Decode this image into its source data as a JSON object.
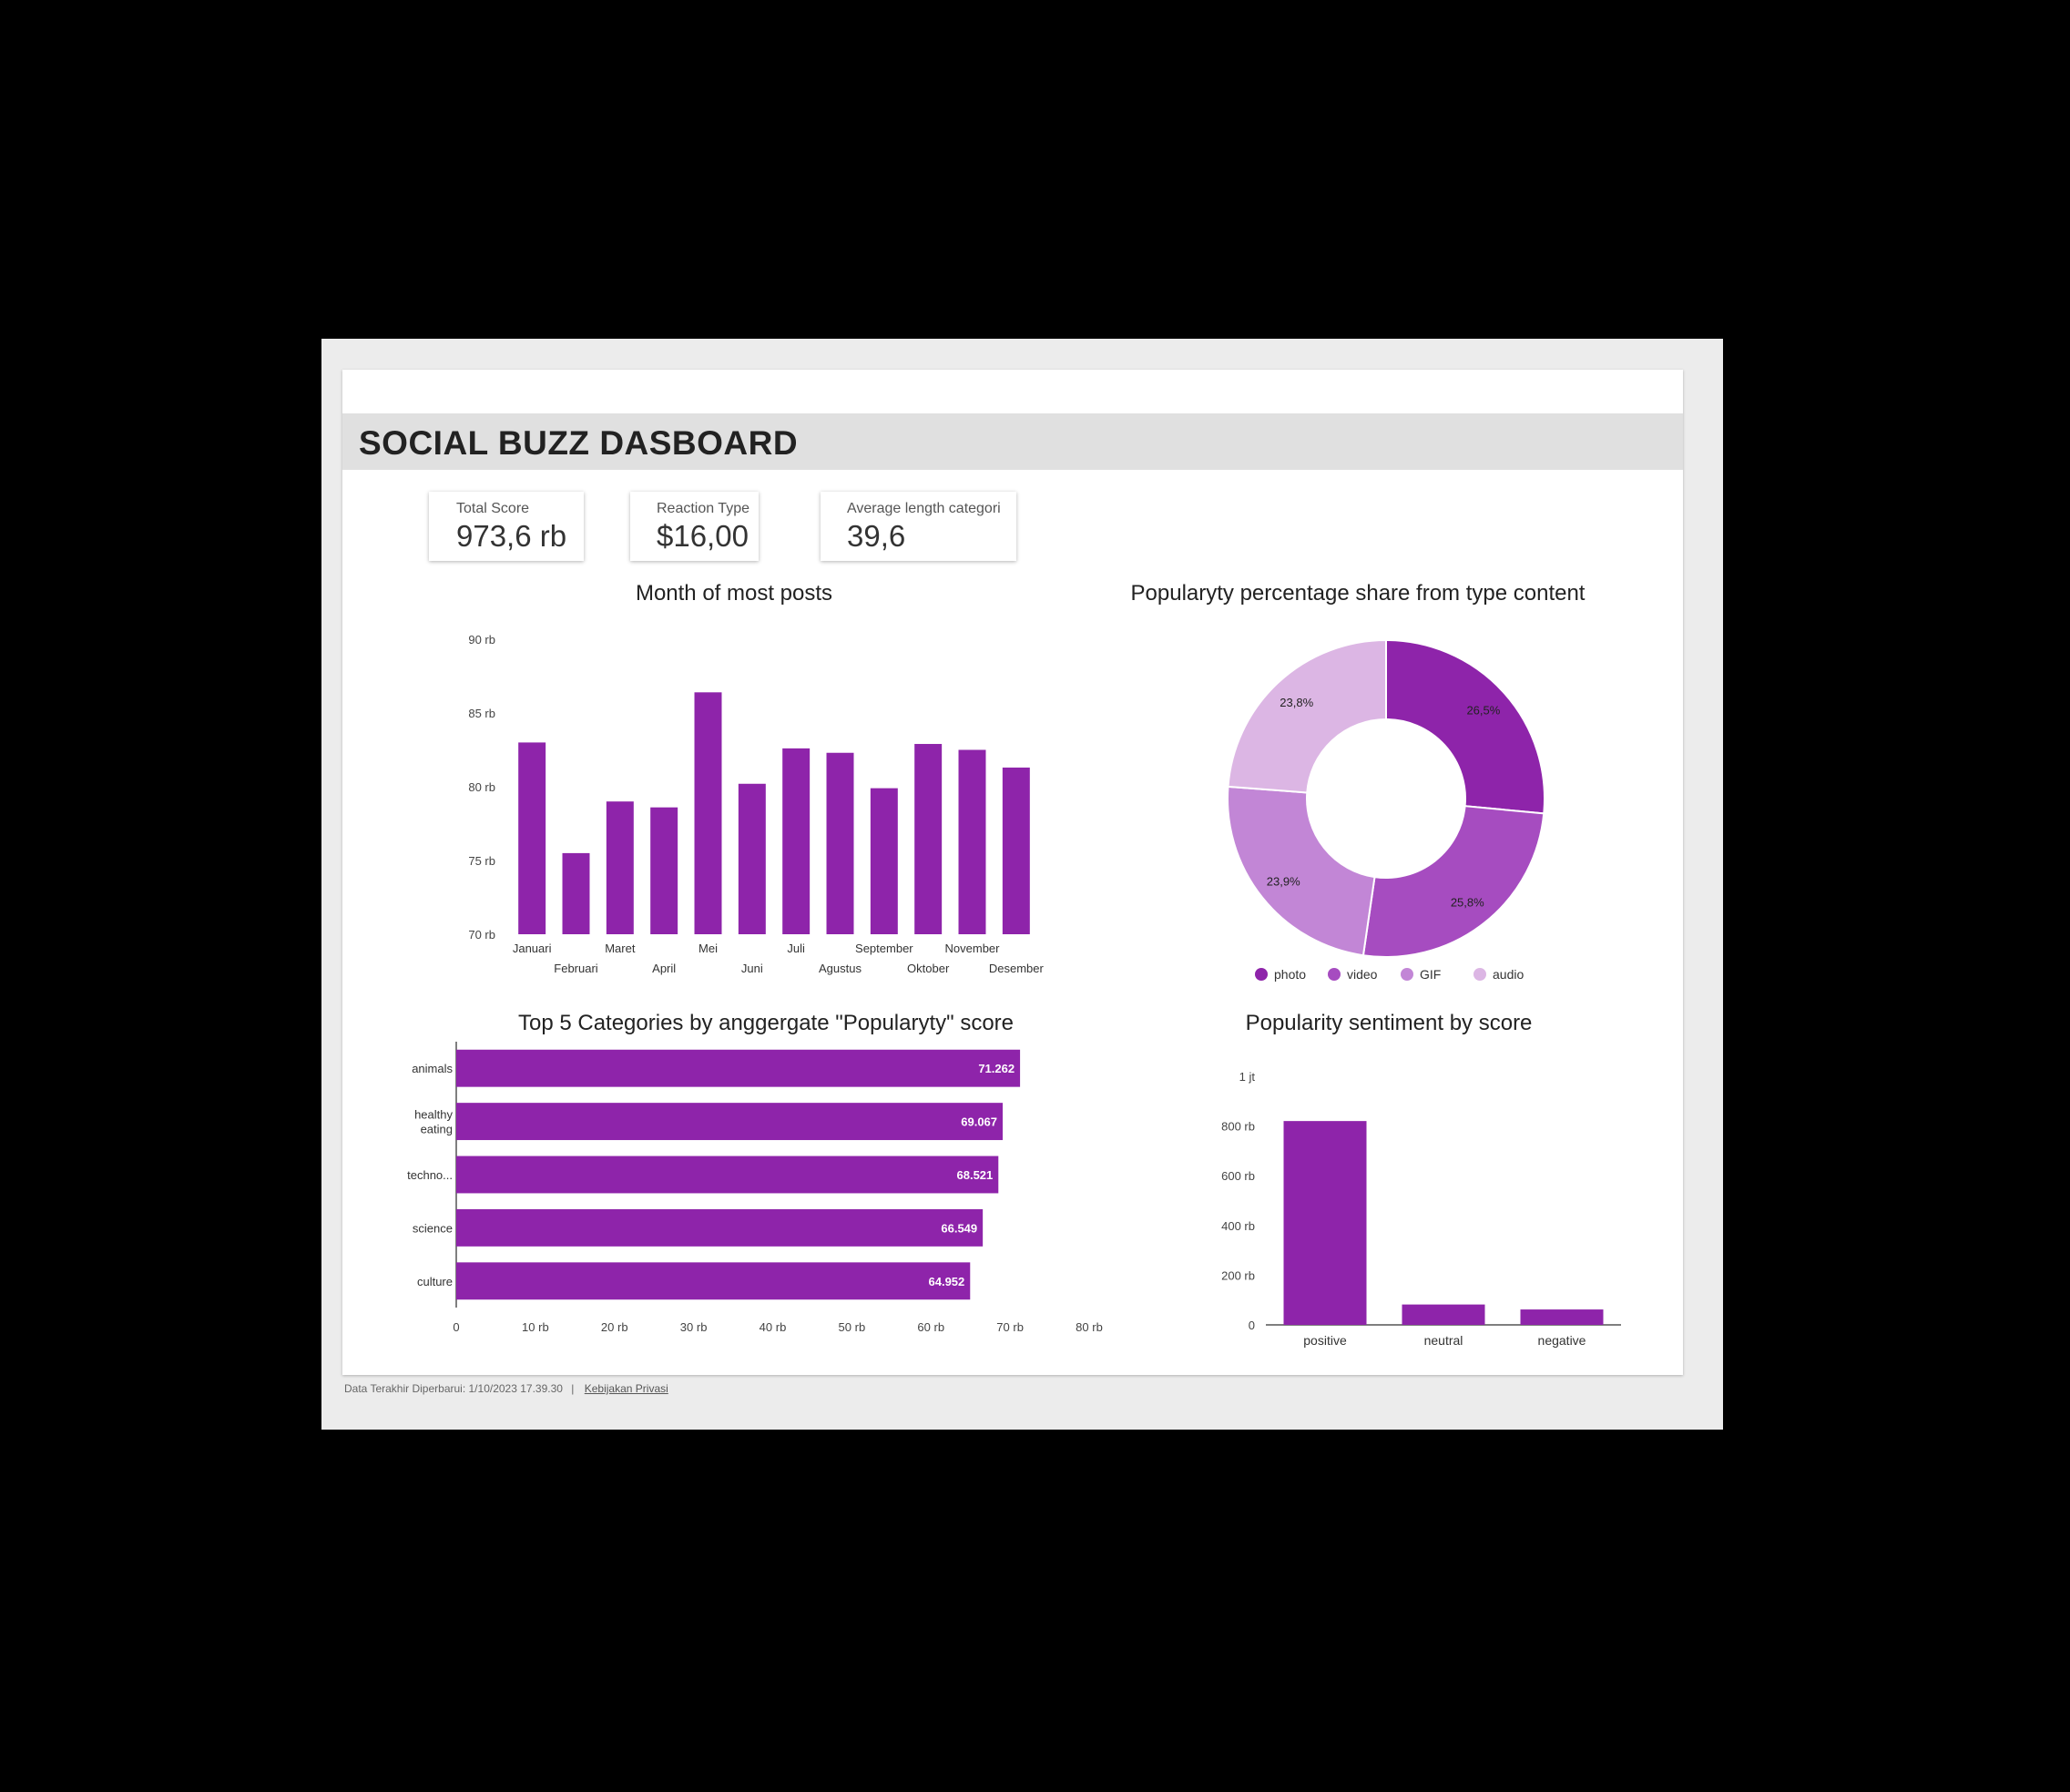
{
  "header": {
    "title": "SOCIAL BUZZ DASBOARD"
  },
  "kpis": [
    {
      "label": "Total Score",
      "value": "973,6 rb"
    },
    {
      "label": "Reaction Type",
      "value": "$16,00"
    },
    {
      "label": "Average length categori",
      "value": "39,6"
    }
  ],
  "footer": {
    "text": "Data Terakhir Diperbarui: 1/10/2023 17.39.30",
    "link": "Kebijakan Privasi"
  },
  "colors": {
    "primary": "#8e24aa",
    "video": "#a64cc0",
    "gif": "#c286d6",
    "audio": "#dcb6e4"
  },
  "chart_data": [
    {
      "id": "monthly",
      "type": "bar",
      "title": "Month of most posts",
      "categories": [
        "Januari",
        "Februari",
        "Maret",
        "April",
        "Mei",
        "Juni",
        "Juli",
        "Agustus",
        "September",
        "Oktober",
        "November",
        "Desember"
      ],
      "values": [
        83000,
        75500,
        79000,
        78600,
        86400,
        80200,
        82600,
        82300,
        79900,
        82900,
        82500,
        81300
      ],
      "ylim": [
        70000,
        90000
      ],
      "yticks": [
        70000,
        75000,
        80000,
        85000,
        90000
      ],
      "ytick_labels": [
        "70 rb",
        "75 rb",
        "80 rb",
        "85 rb",
        "90 rb"
      ],
      "color": "#8e24aa"
    },
    {
      "id": "share",
      "type": "pie",
      "title": "Popularyty percentage share from type content",
      "labels": [
        "photo",
        "video",
        "GIF",
        "audio"
      ],
      "values": [
        26.5,
        25.8,
        23.9,
        23.8
      ],
      "value_labels": [
        "26,5%",
        "25,8%",
        "23,9%",
        "23,8%"
      ],
      "colors": [
        "#8e24aa",
        "#a64cc0",
        "#c286d6",
        "#dcb6e4"
      ],
      "legend": "bottom"
    },
    {
      "id": "top5",
      "type": "bar",
      "orientation": "horizontal",
      "title": "Top 5 Categories by anggergate  \"Popularyty\" score",
      "categories": [
        "animals",
        "healthy eating",
        "techno...",
        "science",
        "culture"
      ],
      "values": [
        71262,
        69067,
        68521,
        66549,
        64952
      ],
      "value_labels": [
        "71.262",
        "69.067",
        "68.521",
        "66.549",
        "64.952"
      ],
      "xlim": [
        0,
        80000
      ],
      "xticks": [
        0,
        10000,
        20000,
        30000,
        40000,
        50000,
        60000,
        70000,
        80000
      ],
      "xtick_labels": [
        "0",
        "10 rb",
        "20 rb",
        "30 rb",
        "40 rb",
        "50 rb",
        "60 rb",
        "70 rb",
        "80 rb"
      ],
      "color": "#8e24aa"
    },
    {
      "id": "sentiment",
      "type": "bar",
      "title": "Popularity sentiment by score",
      "categories": [
        "positive",
        "neutral",
        "negative"
      ],
      "values": [
        820000,
        82000,
        62000
      ],
      "ylim": [
        0,
        1000000
      ],
      "yticks": [
        0,
        200000,
        400000,
        600000,
        800000,
        1000000
      ],
      "ytick_labels": [
        "0",
        "200 rb",
        "400 rb",
        "600 rb",
        "800 rb",
        "1 jt"
      ],
      "color": "#8e24aa"
    }
  ]
}
